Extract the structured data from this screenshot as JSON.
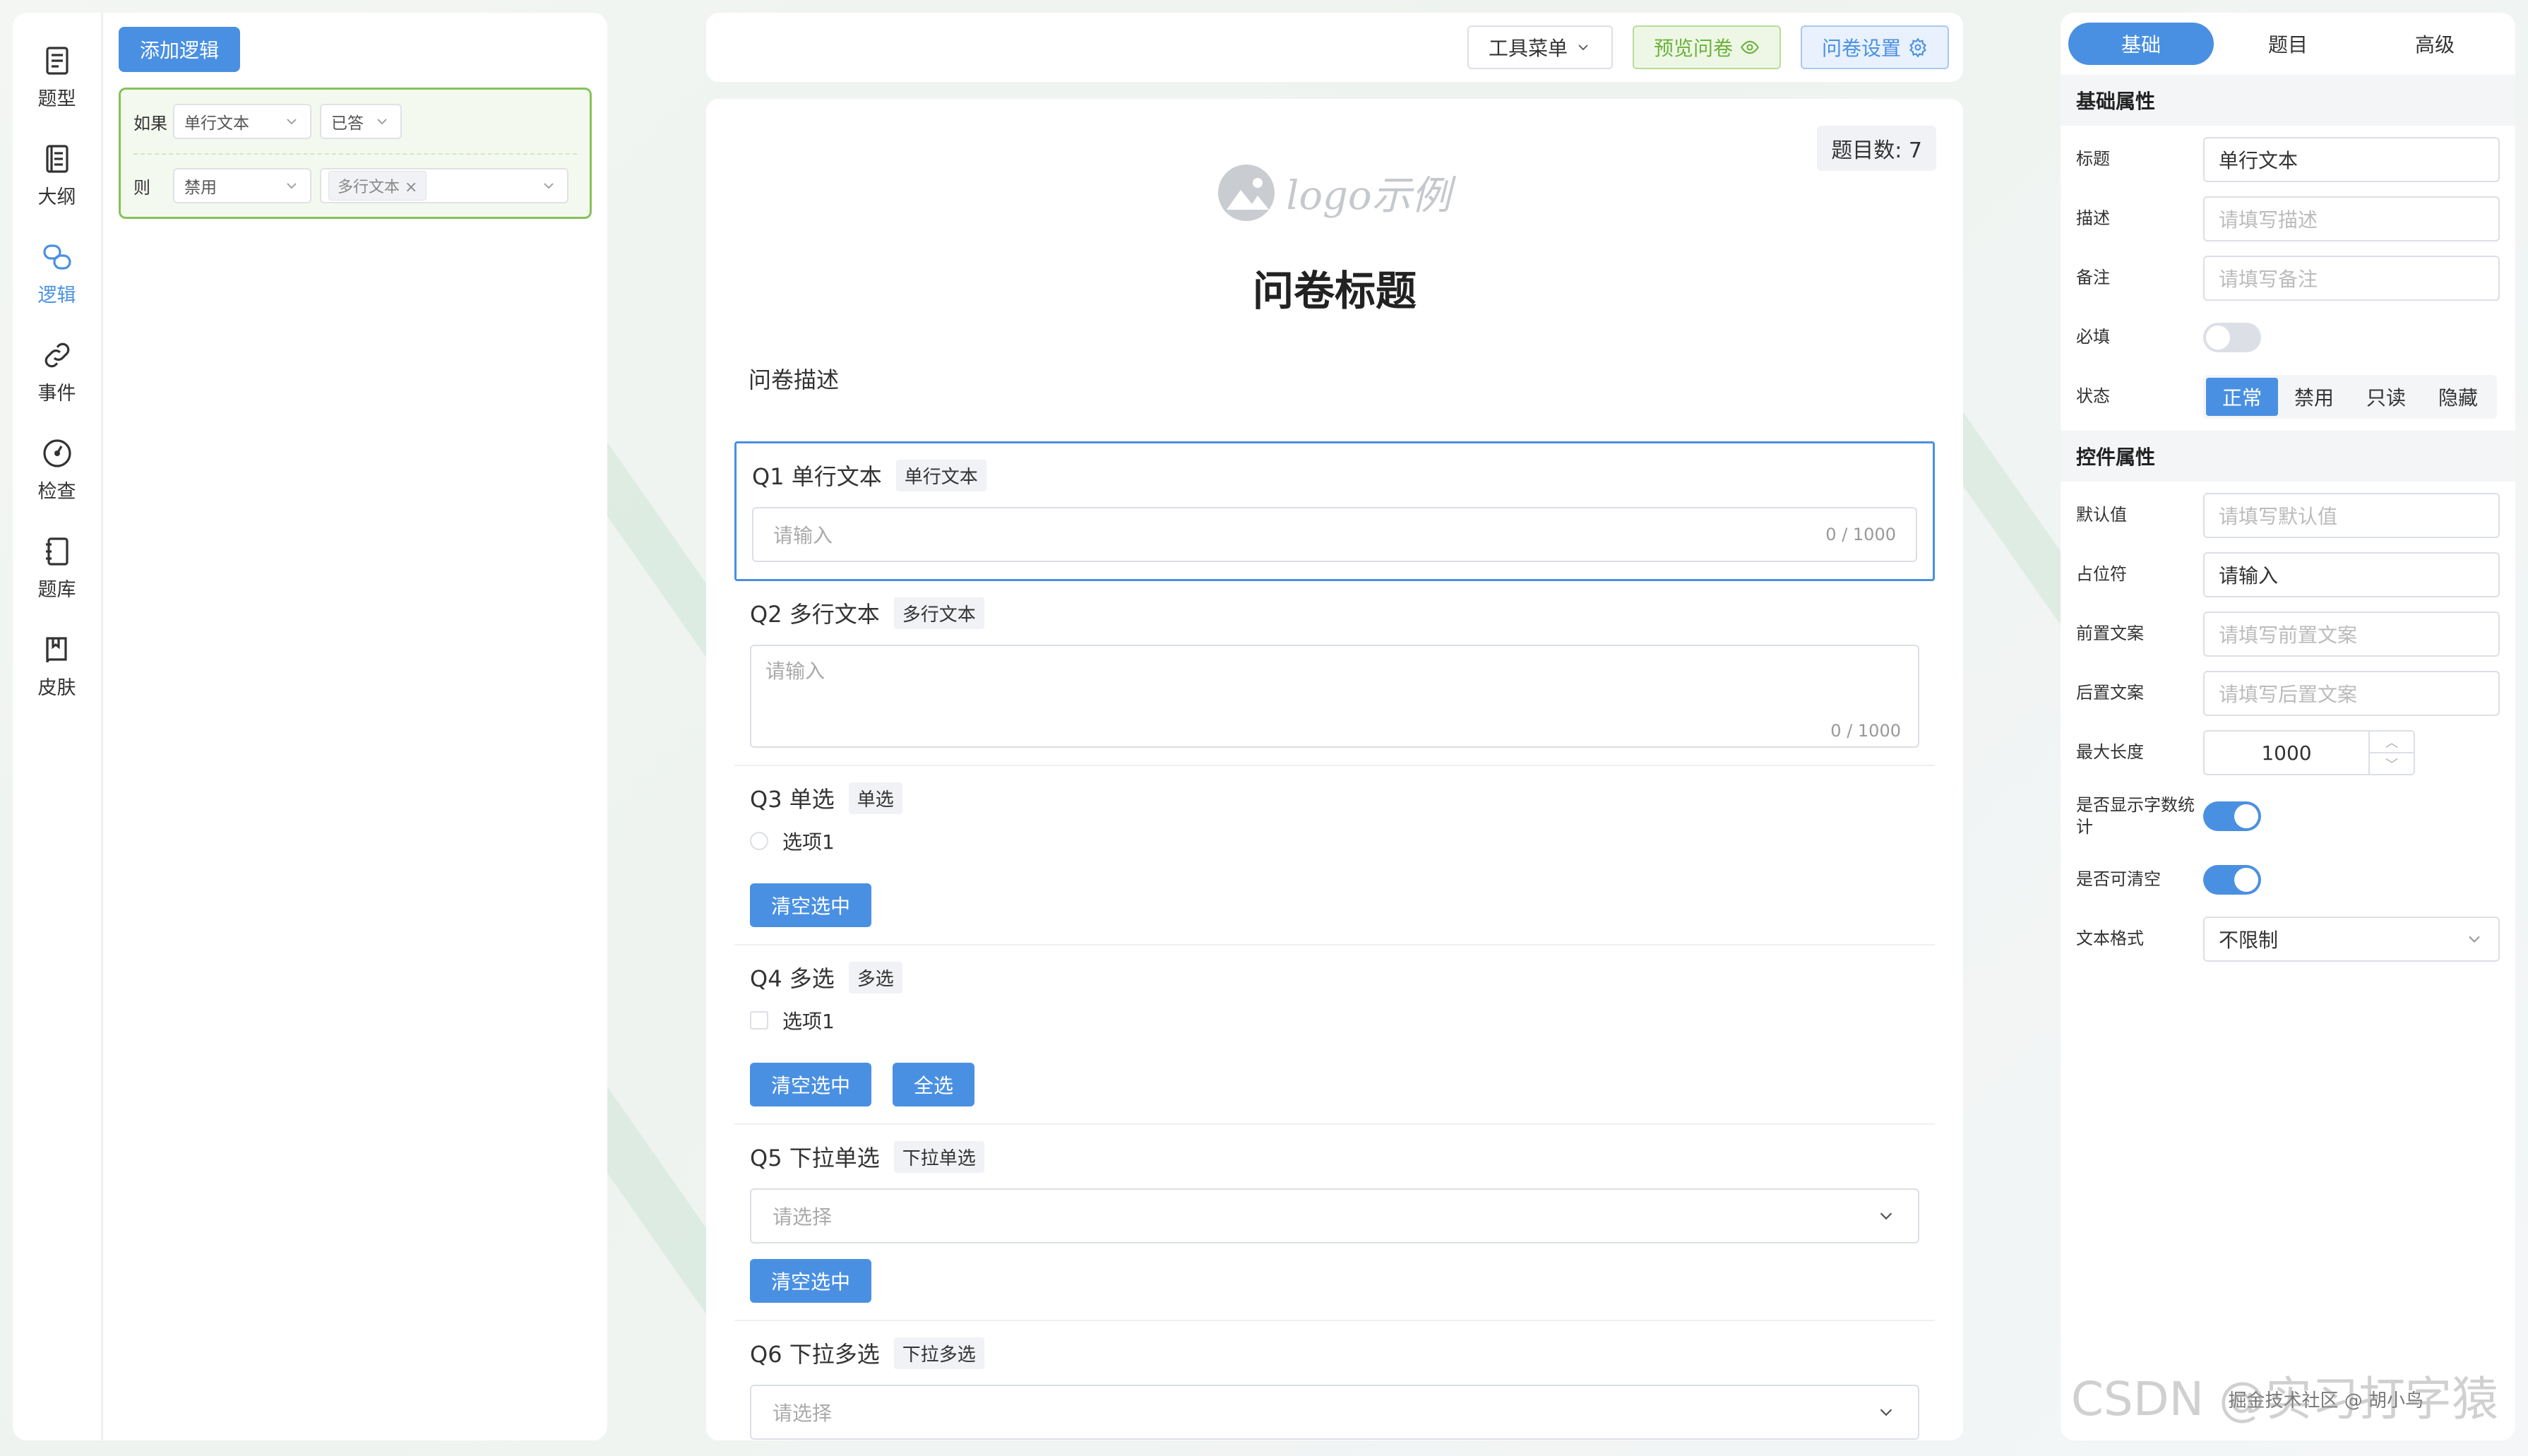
{
  "nav": {
    "items": [
      {
        "label": "题型",
        "icon": "doc-icon"
      },
      {
        "label": "大纲",
        "icon": "outline-icon"
      },
      {
        "label": "逻辑",
        "icon": "logic-icon"
      },
      {
        "label": "事件",
        "icon": "link-icon"
      },
      {
        "label": "检查",
        "icon": "gauge-icon"
      },
      {
        "label": "题库",
        "icon": "notebook-icon"
      },
      {
        "label": "皮肤",
        "icon": "book-icon"
      }
    ],
    "active": "逻辑"
  },
  "logic": {
    "add_button": "添加逻辑",
    "if_label": "如果",
    "if_field": "单行文本",
    "if_condition": "已答",
    "then_label": "则",
    "then_action": "禁用",
    "then_target_tag": "多行文本",
    "tag_remove": "×"
  },
  "toolbar": {
    "tools": "工具菜单",
    "preview": "预览问卷",
    "settings": "问卷设置"
  },
  "survey": {
    "count_label": "题目数: 7",
    "logo_text": "logo示例",
    "title": "问卷标题",
    "description": "问卷描述",
    "questions": [
      {
        "title": "Q1 单行文本",
        "tag": "单行文本",
        "placeholder": "请输入",
        "counter": "0 / 1000"
      },
      {
        "title": "Q2 多行文本",
        "tag": "多行文本",
        "placeholder": "请输入",
        "counter": "0 / 1000"
      },
      {
        "title": "Q3 单选",
        "tag": "单选",
        "option": "选项1",
        "clear": "清空选中"
      },
      {
        "title": "Q4 多选",
        "tag": "多选",
        "option": "选项1",
        "clear": "清空选中",
        "select_all": "全选"
      },
      {
        "title": "Q5 下拉单选",
        "tag": "下拉单选",
        "placeholder": "请选择",
        "clear": "清空选中"
      },
      {
        "title": "Q6 下拉多选",
        "tag": "下拉多选",
        "placeholder": "请选择"
      }
    ]
  },
  "props": {
    "tabs": [
      "基础",
      "题目",
      "高级"
    ],
    "active_tab": "基础",
    "basic_header": "基础属性",
    "control_header": "控件属性",
    "title_label": "标题",
    "title_value": "单行文本",
    "desc_label": "描述",
    "desc_placeholder": "请填写描述",
    "note_label": "备注",
    "note_placeholder": "请填写备注",
    "required_label": "必填",
    "required_on": false,
    "status_label": "状态",
    "status_options": [
      "正常",
      "禁用",
      "只读",
      "隐藏"
    ],
    "status_active": "正常",
    "default_label": "默认值",
    "default_placeholder": "请填写默认值",
    "placeholder_label": "占位符",
    "placeholder_value": "请输入",
    "prefix_label": "前置文案",
    "prefix_placeholder": "请填写前置文案",
    "suffix_label": "后置文案",
    "suffix_placeholder": "请填写后置文案",
    "maxlen_label": "最大长度",
    "maxlen_value": "1000",
    "show_count_label": "是否显示字数统计",
    "show_count_on": true,
    "clearable_label": "是否可清空",
    "clearable_on": true,
    "format_label": "文本格式",
    "format_value": "不限制"
  },
  "watermark": {
    "large": "CSDN @实习打字猿",
    "small": "掘金技术社区 @ 胡小鸟"
  },
  "colors": {
    "primary": "#4a90e2",
    "success": "#6ab23a",
    "logic_border": "#86c25a"
  }
}
